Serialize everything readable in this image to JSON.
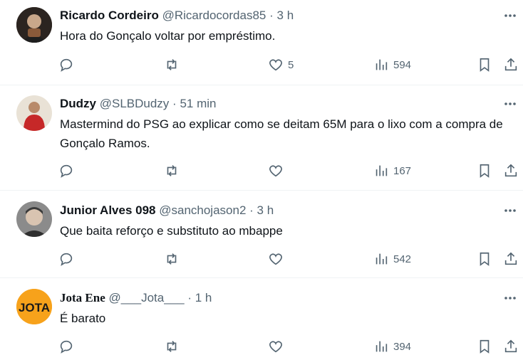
{
  "tweets": [
    {
      "name": "Ricardo Cordeiro",
      "handle": "@Ricardocordas85",
      "time": "3 h",
      "text": "Hora do Gonçalo voltar por empréstimo.",
      "likes": "5",
      "views": "594",
      "avatar_colors": [
        "#5b3b2a",
        "#c8b7a6"
      ]
    },
    {
      "name": "Dudzy",
      "handle": "@SLBDudzy",
      "time": "51 min",
      "text": "Mastermind do PSG ao explicar como se deitam 65M para o lixo com a compra de Gonçalo Ramos.",
      "likes": "",
      "views": "167",
      "avatar_colors": [
        "#c62828",
        "#e9e2d6"
      ]
    },
    {
      "name": "Junior Alves 098",
      "handle": "@sanchojason2",
      "time": "3 h",
      "text": "Que baita reforço e substituto ao mbappe",
      "likes": "",
      "views": "542",
      "avatar_colors": [
        "#6d6d6d",
        "#d9c4b1"
      ]
    },
    {
      "name": "Jota Ene",
      "handle": "@___Jota___",
      "time": "1 h",
      "text": "É barato",
      "likes": "",
      "views": "394",
      "avatar_logo_text": "JOTA",
      "avatar_colors": [
        "#f7a21b",
        "#1a1a1a"
      ]
    }
  ],
  "separator": "·",
  "icons": [
    "reply-icon",
    "retweet-icon",
    "like-icon",
    "views-icon",
    "bookmark-icon",
    "share-icon",
    "more-icon"
  ],
  "colors": {
    "text": "#0f1419",
    "secondary": "#536471",
    "divider": "#eff3f4"
  }
}
